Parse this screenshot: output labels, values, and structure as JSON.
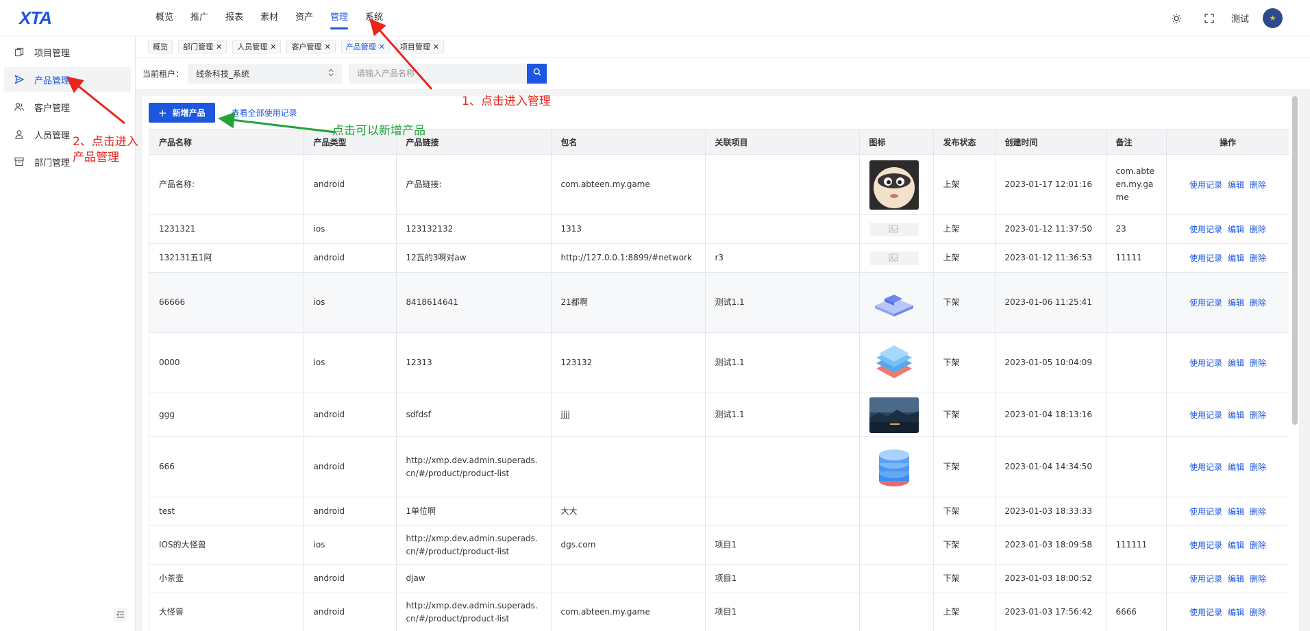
{
  "header": {
    "logo": "XTA",
    "nav": [
      "概览",
      "推广",
      "报表",
      "素材",
      "资产",
      "管理",
      "系统"
    ],
    "active_nav": "管理",
    "user_name": "测试"
  },
  "sidebar": {
    "items": [
      {
        "label": "项目管理",
        "icon": "project-icon",
        "active": false
      },
      {
        "label": "产品管理",
        "icon": "send-icon",
        "active": true
      },
      {
        "label": "客户管理",
        "icon": "customer-icon",
        "active": false
      },
      {
        "label": "人员管理",
        "icon": "user-icon",
        "active": false
      },
      {
        "label": "部门管理",
        "icon": "archive-icon",
        "active": false
      }
    ]
  },
  "tabs": [
    {
      "label": "概览",
      "closable": false,
      "active": false
    },
    {
      "label": "部门管理",
      "closable": true,
      "active": false
    },
    {
      "label": "人员管理",
      "closable": true,
      "active": false
    },
    {
      "label": "客户管理",
      "closable": true,
      "active": false
    },
    {
      "label": "产品管理",
      "closable": true,
      "active": true
    },
    {
      "label": "项目管理",
      "closable": true,
      "active": false
    }
  ],
  "filter": {
    "tenant_label": "当前租户：",
    "tenant_value": "线条科技_系统",
    "search_placeholder": "请输入产品名称"
  },
  "actions": {
    "add_button": "新增产品",
    "view_all_link": "查看全部使用记录"
  },
  "table": {
    "columns": [
      "产品名称",
      "产品类型",
      "产品链接",
      "包名",
      "关联项目",
      "图标",
      "发布状态",
      "创建时间",
      "备注",
      "操作"
    ],
    "row_actions": [
      "使用记录",
      "编辑",
      "删除"
    ],
    "rows": [
      {
        "name": "产品名称:",
        "type": "android",
        "link": "产品链接:",
        "pkg": "com.abteen.my.game",
        "project": "",
        "icon": "panda-avatar",
        "status": "上架",
        "created": "2023-01-17 12:01:16",
        "note": "com.abteen.my.game"
      },
      {
        "name": "1231321",
        "type": "ios",
        "link": "123132132",
        "pkg": "1313",
        "project": "",
        "icon": "image-placeholder",
        "status": "上架",
        "created": "2023-01-12 11:37:50",
        "note": "23"
      },
      {
        "name": "132131五1阿",
        "type": "android",
        "link": "12瓦的3啊对aw",
        "pkg": "http://127.0.0.1:8899/#network",
        "project": "r3",
        "icon": "image-placeholder",
        "status": "上架",
        "created": "2023-01-12 11:36:53",
        "note": "11111"
      },
      {
        "name": "66666",
        "type": "ios",
        "link": "8418614641",
        "pkg": "21都啊",
        "project": "测试1.1",
        "icon": "iso-platform",
        "status": "下架",
        "created": "2023-01-06 11:25:41",
        "note": ""
      },
      {
        "name": "0000",
        "type": "ios",
        "link": "12313",
        "pkg": "123132",
        "project": "测试1.1",
        "icon": "iso-layers",
        "status": "下架",
        "created": "2023-01-05 10:04:09",
        "note": ""
      },
      {
        "name": "ggg",
        "type": "android",
        "link": "sdfdsf",
        "pkg": "jjjj",
        "project": "测试1.1",
        "icon": "night-landscape",
        "status": "下架",
        "created": "2023-01-04 18:13:16",
        "note": ""
      },
      {
        "name": "666",
        "type": "android",
        "link": "http://xmp.dev.admin.superads.cn/#/product/product-list",
        "pkg": "",
        "project": "",
        "icon": "iso-database",
        "status": "下架",
        "created": "2023-01-04 14:34:50",
        "note": ""
      },
      {
        "name": "test",
        "type": "android",
        "link": "1单位啊",
        "pkg": "大大",
        "project": "",
        "icon": "",
        "status": "下架",
        "created": "2023-01-03 18:33:33",
        "note": ""
      },
      {
        "name": "IOS的大怪兽",
        "type": "ios",
        "link": "http://xmp.dev.admin.superads.cn/#/product/product-list",
        "pkg": "dgs.com",
        "project": "项目1",
        "icon": "",
        "status": "下架",
        "created": "2023-01-03 18:09:58",
        "note": "111111"
      },
      {
        "name": "小茶壶",
        "type": "android",
        "link": "djaw",
        "pkg": "",
        "project": "项目1",
        "icon": "",
        "status": "下架",
        "created": "2023-01-03 18:00:52",
        "note": ""
      },
      {
        "name": "大怪兽",
        "type": "android",
        "link": "http://xmp.dev.admin.superads.cn/#/product/product-list",
        "pkg": "com.abteen.my.game",
        "project": "项目1",
        "icon": "",
        "status": "上架",
        "created": "2023-01-03 17:56:42",
        "note": "6666"
      }
    ]
  },
  "annotations": {
    "step1": "1、点击进入管理",
    "step2_line1": "2、点击进入",
    "step2_line2": "产品管理",
    "add_hint": "点击可以新增产品"
  },
  "colors": {
    "primary": "#1d57e0",
    "annotation_red": "#e8261c",
    "annotation_green": "#22a33a"
  }
}
